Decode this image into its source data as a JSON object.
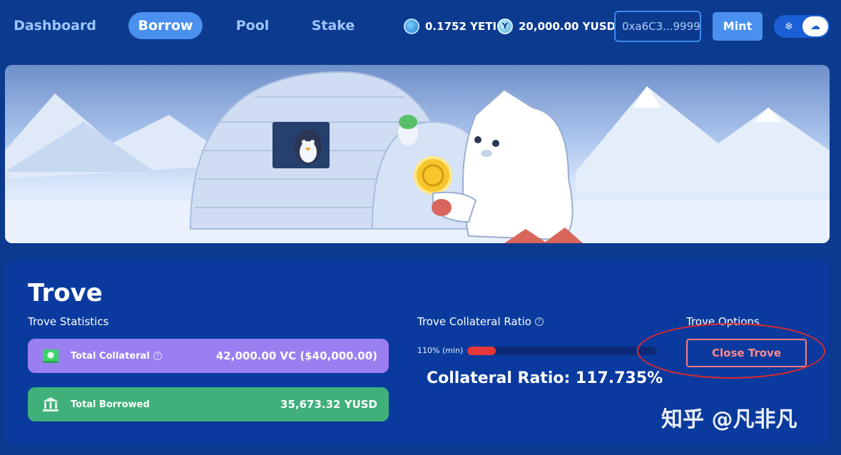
{
  "nav": {
    "items": [
      {
        "label": "Dashboard",
        "active": false
      },
      {
        "label": "Borrow",
        "active": true
      },
      {
        "label": "Pool",
        "active": false
      },
      {
        "label": "Stake",
        "active": false
      }
    ],
    "yeti_balance": "0.1752 YETI",
    "yusd_balance": "20,000.00 YUSD",
    "wallet_address": "0xa6C3...9999",
    "mint_label": "Mint",
    "theme_icons": {
      "left": "snowflake-icon",
      "right": "cloud-icon"
    }
  },
  "trove": {
    "title": "Trove",
    "statistics_label": "Trove Statistics",
    "total_collateral_label": "Total Collateral",
    "total_collateral_value": "42,000.00 VC ($40,000.00)",
    "total_borrowed_label": "Total Borrowed",
    "total_borrowed_value": "35,673.32 YUSD",
    "ratio_label": "Trove Collateral Ratio",
    "min_label": "110% (min)",
    "ratio_fill_fraction": 0.15,
    "collateral_ratio_text": "Collateral Ratio: 117.735%",
    "options_label": "Trove Options",
    "close_label": "Close Trove"
  },
  "colors": {
    "background": "#0b3a8f",
    "accent": "#4a90ee",
    "collateral_pill": "#9a7ff1",
    "borrowed_pill": "#3fb07a",
    "danger": "#e63838"
  },
  "watermark": "知乎 @凡非凡"
}
